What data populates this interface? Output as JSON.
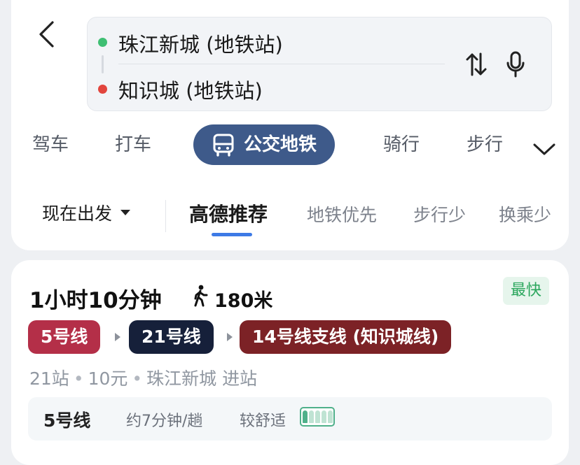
{
  "route": {
    "origin": "珠江新城 (地铁站)",
    "destination": "知识城 (地铁站)"
  },
  "modes": [
    {
      "label": "驾车"
    },
    {
      "label": "打车"
    },
    {
      "label": "公交地铁",
      "active": true
    },
    {
      "label": "骑行"
    },
    {
      "label": "步行"
    }
  ],
  "sort": {
    "depart": "现在出发",
    "tabs": [
      "高德推荐",
      "地铁优先",
      "步行少",
      "换乘少"
    ],
    "active_index": 0
  },
  "result": {
    "duration": "1小时10分钟",
    "walk": "180米",
    "badge": "最快",
    "lines": [
      {
        "name": "5号线",
        "color": "#b42f48"
      },
      {
        "name": "21号线",
        "color": "#16203a"
      },
      {
        "name": "14号线支线 (知识城线)",
        "color": "#7c2226"
      }
    ],
    "stations": "21站",
    "fare": "10元",
    "entry": "珠江新城 进站",
    "info": {
      "line": "5号线",
      "frequency": "约7分钟/趟",
      "comfort": "较舒适"
    }
  },
  "colors": {
    "accent": "#3e5a8a",
    "underline": "#3d7ae6",
    "badge_green": "#2aa65c",
    "origin_dot": "#3fbf73",
    "dest_dot": "#e2453d"
  },
  "icons": [
    "back-arrow-icon",
    "swap-icon",
    "microphone-icon",
    "bus-icon",
    "chevron-down-icon",
    "walking-person-icon",
    "crowd-level-icon"
  ]
}
